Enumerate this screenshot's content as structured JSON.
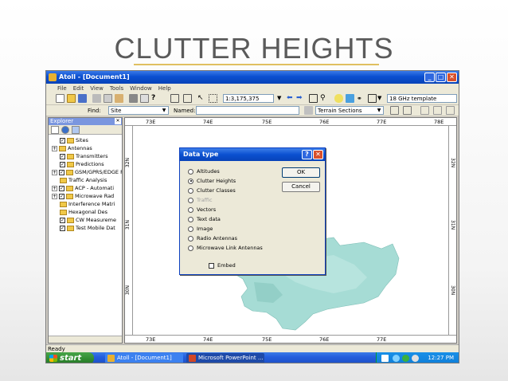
{
  "slide": {
    "title": "CLUTTER HEIGHTS"
  },
  "app": {
    "window_title": "Atoll - [Document1]",
    "menu": [
      "File",
      "Edit",
      "View",
      "Tools",
      "Window",
      "Help"
    ],
    "scale": "1:3,175,375",
    "template": "18 GHz template",
    "find_label": "Find:",
    "find_value": "Site",
    "named_label": "Named:",
    "named_value": "",
    "terrain_value": "Terrain Sections",
    "status": "Ready"
  },
  "explorer": {
    "title": "Explorer",
    "items": [
      {
        "label": "Sites",
        "checked": true,
        "expander": "",
        "indent": 1
      },
      {
        "label": "Antennas",
        "checked": false,
        "expander": "+",
        "indent": 0,
        "no_checkbox": true
      },
      {
        "label": "Transmitters",
        "checked": true,
        "expander": "",
        "indent": 1
      },
      {
        "label": "Predictions",
        "checked": true,
        "expander": "",
        "indent": 1
      },
      {
        "label": "GSM/GPRS/EDGE P",
        "checked": true,
        "expander": "+",
        "indent": 0
      },
      {
        "label": "Traffic Analysis",
        "checked": false,
        "expander": "",
        "indent": 1,
        "no_checkbox": true
      },
      {
        "label": "ACP - Automati",
        "checked": true,
        "expander": "+",
        "indent": 0
      },
      {
        "label": "Microwave Rad",
        "checked": true,
        "expander": "+",
        "indent": 0
      },
      {
        "label": "Interference Matri",
        "checked": false,
        "expander": "",
        "indent": 1,
        "no_checkbox": true
      },
      {
        "label": "Hexagonal Des",
        "checked": false,
        "expander": "",
        "indent": 1,
        "no_checkbox": true
      },
      {
        "label": "CW Measureme",
        "checked": true,
        "expander": "",
        "indent": 1
      },
      {
        "label": "Test Mobile Dat",
        "checked": true,
        "expander": "",
        "indent": 1
      }
    ]
  },
  "map": {
    "top_ticks": [
      "73E",
      "74E",
      "75E",
      "76E",
      "77E",
      "78E"
    ],
    "bottom_ticks": [
      "73E",
      "74E",
      "75E",
      "76E",
      "77E"
    ],
    "left_ticks": [
      "32N",
      "31N",
      "30N"
    ],
    "right_ticks": [
      "32N",
      "31N",
      "30N"
    ],
    "region_color": "#9fd6d0"
  },
  "dialog": {
    "title": "Data type",
    "options": [
      {
        "label": "Altitudes",
        "selected": false,
        "disabled": false
      },
      {
        "label": "Clutter Heights",
        "selected": true,
        "disabled": false
      },
      {
        "label": "Clutter Classes",
        "selected": false,
        "disabled": false
      },
      {
        "label": "Traffic",
        "selected": false,
        "disabled": true
      },
      {
        "label": "Vectors",
        "selected": false,
        "disabled": false
      },
      {
        "label": "Text data",
        "selected": false,
        "disabled": false
      },
      {
        "label": "Image",
        "selected": false,
        "disabled": false
      },
      {
        "label": "Radio Antennas",
        "selected": false,
        "disabled": false
      },
      {
        "label": "Microwave Link Antennas",
        "selected": false,
        "disabled": false
      }
    ],
    "ok_label": "OK",
    "cancel_label": "Cancel",
    "embed_label": "Embed",
    "embed_checked": false
  },
  "taskbar": {
    "start_label": "start",
    "items": [
      "Atoll - [Document1]",
      "Microsoft PowerPoint ..."
    ],
    "clock": "12:27 PM"
  },
  "colors": {
    "titlebar": "#0a4fd0",
    "title_rule": "#e0c060",
    "start": "#2f8a2f"
  }
}
